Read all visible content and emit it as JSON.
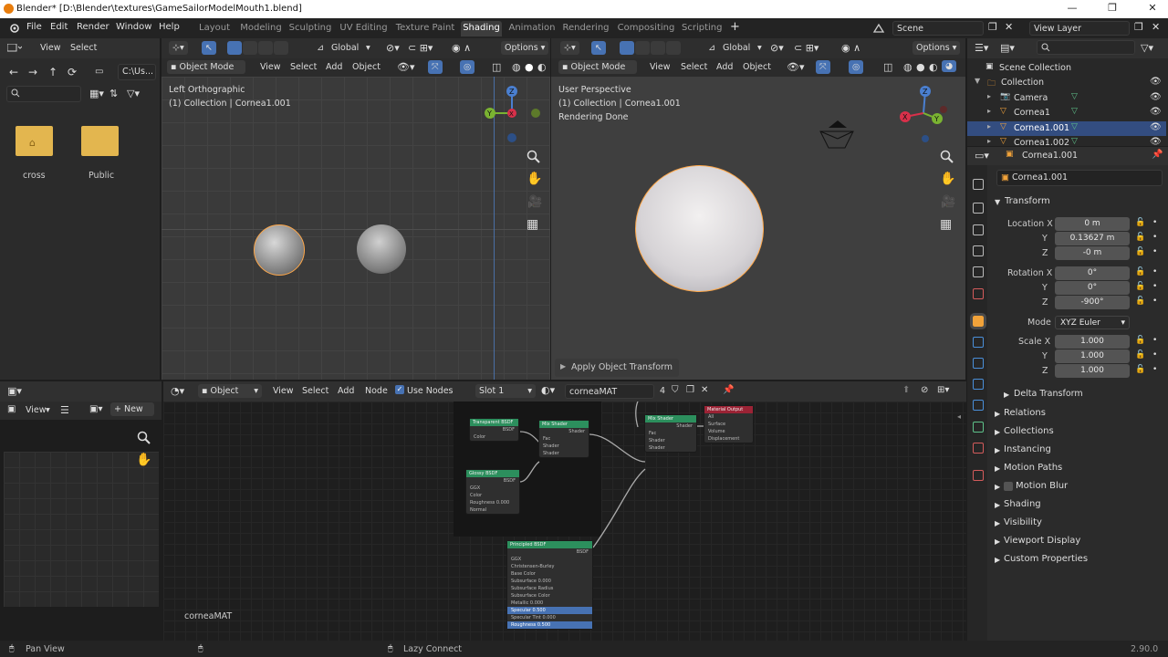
{
  "window": {
    "title": "Blender* [D:\\Blender\\textures\\GameSailorModelMouth1.blend]",
    "controls": [
      "—",
      "❐",
      "✕"
    ]
  },
  "menu": {
    "items": [
      "File",
      "Edit",
      "Render",
      "Window",
      "Help"
    ]
  },
  "workspaces": [
    "Layout",
    "Modeling",
    "Sculpting",
    "UV Editing",
    "Texture Paint",
    "Shading",
    "Animation",
    "Rendering",
    "Compositing",
    "Scripting"
  ],
  "active_workspace": "Shading",
  "scene": {
    "name": "Scene",
    "view_layer": "View Layer"
  },
  "filebrowser": {
    "header": [
      "View",
      "Select"
    ],
    "path": "C:\\Us...",
    "items": [
      "cross",
      "Public"
    ]
  },
  "viewport_left": {
    "mode": "Object Mode",
    "menus": [
      "View",
      "Select",
      "Add",
      "Object"
    ],
    "orientation": "Global",
    "options": "Options",
    "info1": "Left Orthographic",
    "info2": "(1) Collection | Cornea1.001"
  },
  "viewport_right": {
    "mode": "Object Mode",
    "menus": [
      "View",
      "Select",
      "Add",
      "Object"
    ],
    "orientation": "Global",
    "options": "Options",
    "info1": "User Perspective",
    "info2": "(1) Collection | Cornea1.001",
    "info3": "Rendering Done",
    "apply": "Apply Object Transform"
  },
  "node_editor": {
    "type": "Object",
    "menus": [
      "View",
      "Select",
      "Add",
      "Node"
    ],
    "use_nodes": "Use Nodes",
    "slot": "Slot 1",
    "material": "corneaMAT",
    "users": "4",
    "footer_label": "corneaMAT",
    "nodes": {
      "transparent": {
        "title": "Transparent BSDF",
        "out": "BSDF",
        "rows": [
          "Color"
        ]
      },
      "glossy": {
        "title": "Glossy BSDF",
        "out": "BSDF",
        "rows": [
          "GGX",
          "Color",
          "Roughness  0.000",
          "Normal"
        ]
      },
      "mix1": {
        "title": "Mix Shader",
        "out": "Shader",
        "rows": [
          "Fac",
          "Shader",
          "Shader"
        ]
      },
      "mix2": {
        "title": "Mix Shader",
        "out": "Shader",
        "rows": [
          "Fac",
          "Shader",
          "Shader"
        ]
      },
      "output": {
        "title": "Material Output",
        "rows": [
          "All",
          "Surface",
          "Volume",
          "Displacement"
        ]
      },
      "principled": {
        "title": "Principled BSDF",
        "out": "BSDF",
        "rows": [
          "GGX",
          "Christensen-Burley",
          "Base Color",
          "Subsurface  0.000",
          "Subsurface Radius",
          "Subsurface Color",
          "Metallic  0.000",
          "Specular  0.500",
          "Specular Tint  0.000",
          "Roughness  0.500"
        ]
      }
    }
  },
  "image_editor": {
    "view": "View",
    "new": "New"
  },
  "outliner": {
    "root": "Scene Collection",
    "items": [
      {
        "name": "Collection",
        "depth": 1,
        "color": "#ddd"
      },
      {
        "name": "Camera",
        "depth": 2,
        "color": "#ddd"
      },
      {
        "name": "Cornea1",
        "depth": 2,
        "color": "#ddd"
      },
      {
        "name": "Cornea1.001",
        "depth": 2,
        "color": "#fff",
        "selected": true
      },
      {
        "name": "Cornea1.002",
        "depth": 2,
        "color": "#ddd"
      }
    ]
  },
  "properties": {
    "object_name": "Cornea1.001",
    "data_name": "Cornea1.001",
    "transform_label": "Transform",
    "location": {
      "label": "Location X",
      "x": "0 m",
      "y": "0.13627 m",
      "z": "-0 m"
    },
    "rotation": {
      "label": "Rotation X",
      "x": "0°",
      "y": "0°",
      "z": "-900°"
    },
    "mode_label": "Mode",
    "mode": "XYZ Euler",
    "scale": {
      "label": "Scale X",
      "x": "1.000",
      "y": "1.000",
      "z": "1.000"
    },
    "axis": {
      "y": "Y",
      "z": "Z"
    },
    "delta": "Delta Transform",
    "sections": [
      "Relations",
      "Collections",
      "Instancing",
      "Motion Paths",
      "Motion Blur",
      "Shading",
      "Visibility",
      "Viewport Display",
      "Custom Properties"
    ]
  },
  "status": {
    "left": "Pan View",
    "mid": "Lazy Connect",
    "version": "2.90.0"
  },
  "accent": {
    "selection": "#ffa84a",
    "active_tab": "#4772b3",
    "node_shader": "#2c8f5d",
    "node_output": "#9b2335"
  }
}
